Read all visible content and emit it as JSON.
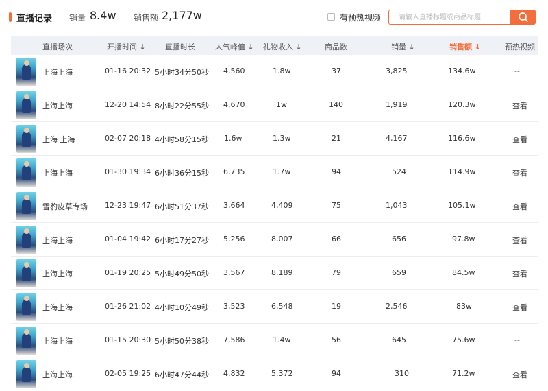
{
  "header": {
    "title": "直播记录",
    "sales_label": "销量",
    "sales_value": "8.4w",
    "revenue_label": "销售额",
    "revenue_value": "2,177w",
    "preheat_filter_label": "有预热视频",
    "search_placeholder": "请输入直播标题或商品标题",
    "accent_color": "#f46d3c"
  },
  "columns": {
    "session": "直播场次",
    "start_time": "开播时间 ↓",
    "duration": "直播时长",
    "peak": "人气峰值 ↓",
    "gift": "礼物收入 ↓",
    "goods": "商品数",
    "sales": "销量 ↓",
    "revenue": "销售额 ↓",
    "preheat": "预热视频"
  },
  "rows": [
    {
      "name": "上海上海",
      "time": "01-16 20:32",
      "duration": "5小时34分50秒",
      "peak": "4,560",
      "gift": "1.8w",
      "goods": "37",
      "sales": "3,825",
      "revenue": "134.6w",
      "preheat": "--"
    },
    {
      "name": "上海上海",
      "time": "12-20 14:54",
      "duration": "8小时22分55秒",
      "peak": "4,670",
      "gift": "1w",
      "goods": "140",
      "sales": "1,919",
      "revenue": "120.3w",
      "preheat": "查看"
    },
    {
      "name": "上海 上海",
      "time": "02-07 20:18",
      "duration": "4小时58分15秒",
      "peak": "1.6w",
      "gift": "1.3w",
      "goods": "21",
      "sales": "4,167",
      "revenue": "116.6w",
      "preheat": "查看"
    },
    {
      "name": "上海上海",
      "time": "01-30 19:34",
      "duration": "6小时36分15秒",
      "peak": "6,735",
      "gift": "1.7w",
      "goods": "94",
      "sales": "524",
      "revenue": "114.9w",
      "preheat": "查看"
    },
    {
      "name": "雪豹皮草专场",
      "time": "12-23 19:47",
      "duration": "6小时51分37秒",
      "peak": "3,664",
      "gift": "4,409",
      "goods": "75",
      "sales": "1,043",
      "revenue": "105.1w",
      "preheat": "查看"
    },
    {
      "name": "上海上海",
      "time": "01-04 19:42",
      "duration": "6小时17分27秒",
      "peak": "5,256",
      "gift": "8,007",
      "goods": "66",
      "sales": "656",
      "revenue": "97.8w",
      "preheat": "查看"
    },
    {
      "name": "上海上海",
      "time": "01-19 20:25",
      "duration": "5小时49分50秒",
      "peak": "3,567",
      "gift": "8,189",
      "goods": "79",
      "sales": "659",
      "revenue": "84.5w",
      "preheat": "查看"
    },
    {
      "name": "上海上海",
      "time": "01-26 21:02",
      "duration": "4小时10分49秒",
      "peak": "3,523",
      "gift": "6,548",
      "goods": "19",
      "sales": "2,546",
      "revenue": "83w",
      "preheat": "查看"
    },
    {
      "name": "上海上海",
      "time": "01-15 20:30",
      "duration": "5小时50分38秒",
      "peak": "7,586",
      "gift": "1.4w",
      "goods": "56",
      "sales": "645",
      "revenue": "75.6w",
      "preheat": "--"
    },
    {
      "name": "上海上海",
      "time": "02-05 19:25",
      "duration": "6小时47分44秒",
      "peak": "4,832",
      "gift": "5,372",
      "goods": "94",
      "sales": "310",
      "revenue": "71.2w",
      "preheat": "查看"
    }
  ]
}
